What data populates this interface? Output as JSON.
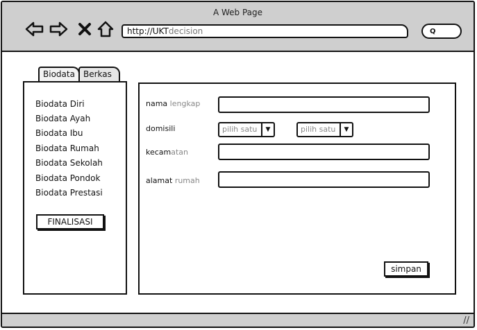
{
  "window": {
    "title": "A Web Page"
  },
  "toolbar": {
    "back_icon": "arrow-left-icon",
    "forward_icon": "arrow-right-icon",
    "close_icon": "x-icon",
    "home_icon": "home-icon",
    "url_prefix": "http://UKT",
    "url_suffix": "decision",
    "search_icon": "search-icon"
  },
  "tabs": [
    {
      "label": "Biodata"
    },
    {
      "label": "Berkas"
    }
  ],
  "sidebar": {
    "items": [
      {
        "label": "Biodata Diri"
      },
      {
        "label": "Biodata Ayah"
      },
      {
        "label": "Biodata Ibu"
      },
      {
        "label": "Biodata Rumah"
      },
      {
        "label": "Biodata Sekolah"
      },
      {
        "label": "Biodata Pondok"
      },
      {
        "label": "Biodata Prestasi"
      }
    ],
    "final_button": "FINALISASI"
  },
  "form": {
    "nama": {
      "label_a": "nama ",
      "label_b": "lengkap",
      "value": ""
    },
    "domisili": {
      "label": "domisili",
      "select1": "pilih satu",
      "select2": "pilih satu"
    },
    "kecamatan": {
      "label_a": "kecam",
      "label_b": "atan",
      "value": ""
    },
    "alamat": {
      "label_a": "alamat ",
      "label_b": "rumah",
      "value": ""
    },
    "save_button": "simpan"
  }
}
